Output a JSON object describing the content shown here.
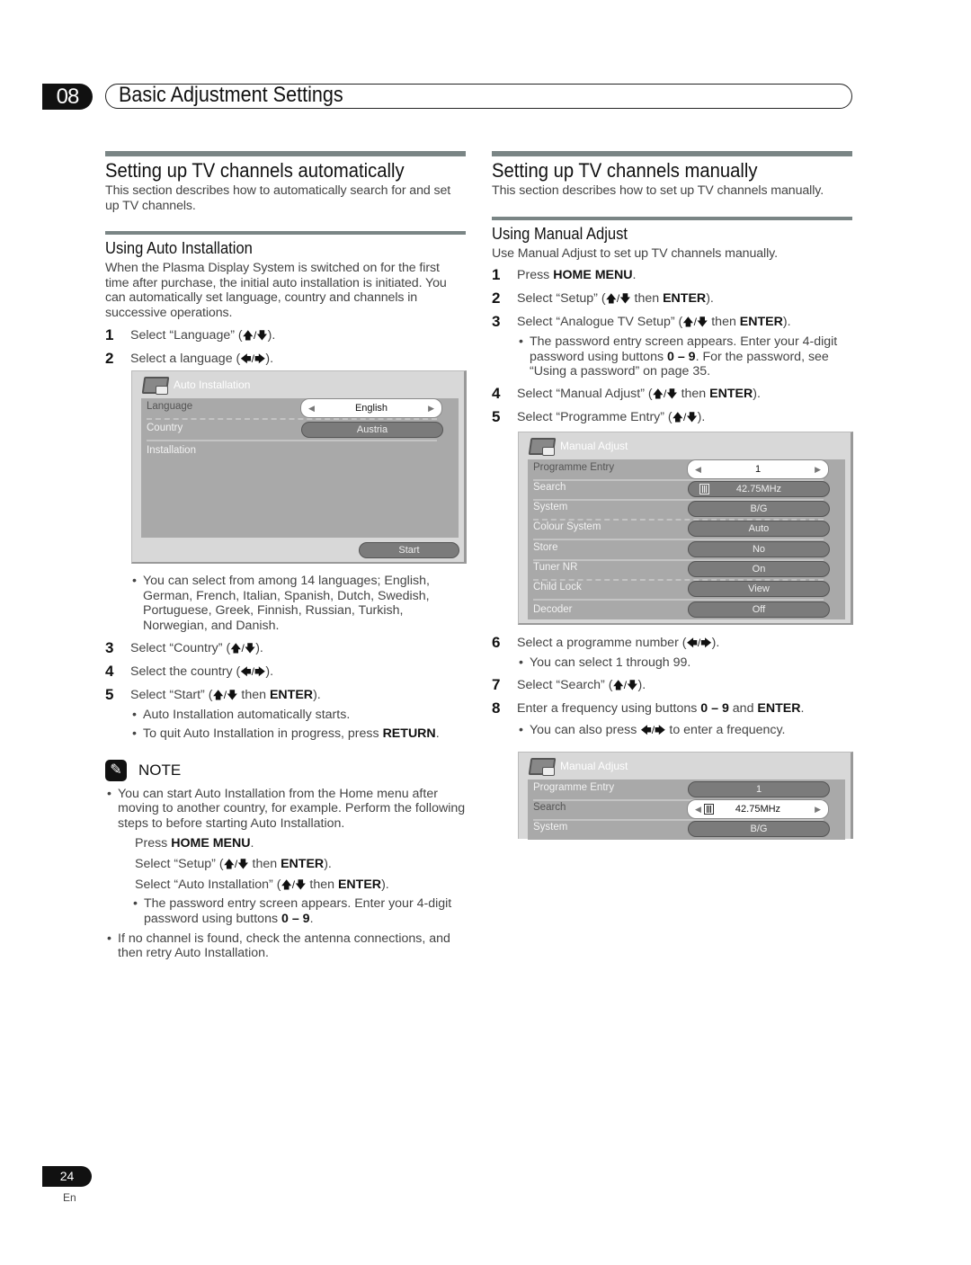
{
  "header": {
    "chapter_number": "08",
    "chapter_title": "Basic Adjustment Settings"
  },
  "left": {
    "title": "Setting up TV channels automatically",
    "intro": "This section describes how to automatically search for and set up TV channels.",
    "subtitle": "Using Auto Installation",
    "subintro": "When the Plasma Display System is switched on for the first time after purchase, the initial auto installation is initiated. You can automatically set language, country and channels in successive operations.",
    "steps_a": [
      {
        "n": "1",
        "text": "Select “Language” (",
        "arrows": "🡅/🡇",
        "tail": ")."
      },
      {
        "n": "2",
        "text": "Select a language (",
        "arrows": "🡄/🡆",
        "tail": ")."
      }
    ],
    "osd": {
      "title": "Auto Installation",
      "rows": [
        {
          "label": "Language",
          "value": "English",
          "selected": true
        },
        {
          "label": "Country",
          "value": "Austria",
          "selected": false
        },
        {
          "label": "Installation",
          "value": ""
        }
      ],
      "start_button": "Start"
    },
    "bullet_languages": "You can select from among 14 languages; English, German, French, Italian, Spanish, Dutch, Swedish, Portuguese, Greek, Finnish, Russian, Turkish, Norwegian, and Danish.",
    "steps_b": [
      {
        "n": "3",
        "text": "Select “Country” (",
        "arrows": "🡅/🡇",
        "tail": ")."
      },
      {
        "n": "4",
        "text": "Select the country (",
        "arrows": "🡄/🡆",
        "tail": ")."
      },
      {
        "n": "5",
        "text": "Select “Start” (",
        "arrows": "🡅/🡇",
        "mid": " then ",
        "key": "ENTER",
        "tail": ")."
      }
    ],
    "bullets_b": [
      {
        "text": "Auto Installation automatically starts."
      },
      {
        "text": "To quit Auto Installation in progress, press ",
        "key": "RETURN",
        "tail": "."
      }
    ],
    "note": {
      "label": "NOTE",
      "bullet1": "You can start Auto Installation from the Home menu after moving to another country, for example. Perform the following steps    to    before starting Auto Installation.",
      "substeps": [
        {
          "text": "Press ",
          "key": "HOME MENU",
          "tail": "."
        },
        {
          "text": "Select “Setup” (",
          "arrows": "🡅/🡇",
          "mid": " then ",
          "key": "ENTER",
          "tail": ")."
        },
        {
          "text": "Select “Auto Installation” (",
          "arrows": "🡅/🡇",
          "mid": " then ",
          "key": "ENTER",
          "tail": ")."
        }
      ],
      "subbullet": {
        "text": "The password entry screen appears. Enter your 4-digit password using buttons ",
        "key": "0 – 9",
        "tail": "."
      },
      "bullet2": "If no channel is found, check the antenna connections, and then retry Auto Installation."
    }
  },
  "right": {
    "title": "Setting up TV channels manually",
    "intro": "This section describes how to set up TV channels manually.",
    "subtitle": "Using Manual Adjust",
    "subintro": "Use Manual Adjust to set up TV channels manually.",
    "steps_a": [
      {
        "n": "1",
        "text": "Press ",
        "key": "HOME MENU",
        "tail": "."
      },
      {
        "n": "2",
        "text": "Select “Setup” (",
        "arrows": "🡅/🡇",
        "mid": " then ",
        "key": "ENTER",
        "tail": ")."
      },
      {
        "n": "3",
        "text": "Select “Analogue TV Setup” (",
        "arrows": "🡅/🡇",
        "mid": " then ",
        "key": "ENTER",
        "tail": ")."
      }
    ],
    "bullet_password": {
      "text": "The password entry screen appears. Enter your 4-digit password using buttons ",
      "key": "0 – 9",
      "tail": ". For the password, see “Using a password” on page 35."
    },
    "steps_b": [
      {
        "n": "4",
        "text": "Select “Manual Adjust” (",
        "arrows": "🡅/🡇",
        "mid": " then ",
        "key": "ENTER",
        "tail": ")."
      },
      {
        "n": "5",
        "text": "Select “Programme Entry” (",
        "arrows": "🡅/🡇",
        "tail": ")."
      }
    ],
    "osd1": {
      "title": "Manual Adjust",
      "rows": [
        {
          "label": "Programme Entry",
          "value": "1"
        },
        {
          "label": "Search",
          "value": "42.75MHz"
        },
        {
          "label": "System",
          "value": "B/G"
        },
        {
          "label": "Colour System",
          "value": "Auto"
        },
        {
          "label": "Store",
          "value": "No"
        },
        {
          "label": "Tuner NR",
          "value": "On"
        },
        {
          "label": "Child Lock",
          "value": "View"
        },
        {
          "label": "Decoder",
          "value": "Off"
        }
      ]
    },
    "steps_c": [
      {
        "n": "6",
        "text": "Select a programme number (",
        "arrows": "🡄/🡆",
        "tail": ")."
      }
    ],
    "bullet_range": "You can select 1 through 99.",
    "steps_d": [
      {
        "n": "7",
        "text": "Select “Search” (",
        "arrows": "🡅/🡇",
        "tail": ")."
      },
      {
        "n": "8",
        "text": "Enter a frequency using buttons ",
        "key": "0 – 9",
        "mid2": " and ",
        "key2": "ENTER",
        "tail": "."
      }
    ],
    "bullet_freq": {
      "text": "You can also press ",
      "arrows": "🡄/🡆",
      "tail": " to enter a frequency."
    },
    "osd2": {
      "title": "Manual Adjust",
      "rows": [
        {
          "label": "Programme Entry",
          "value": "1"
        },
        {
          "label": "Search",
          "value": "42.75MHz"
        },
        {
          "label": "System",
          "value": "B/G"
        }
      ]
    }
  },
  "footer": {
    "page_number": "24",
    "language": "En"
  }
}
